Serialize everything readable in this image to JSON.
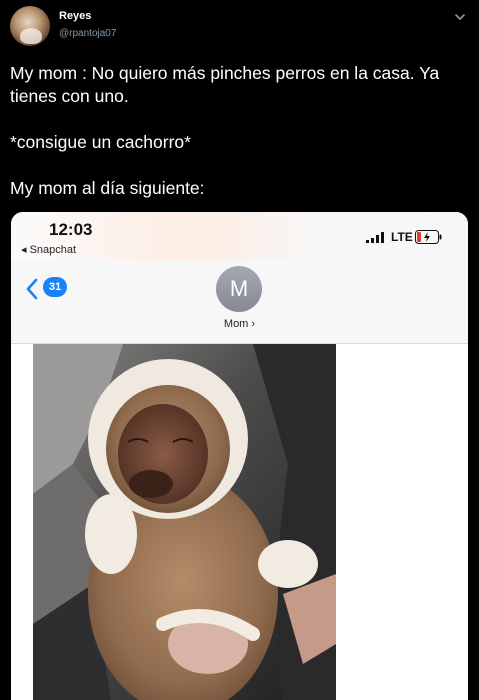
{
  "tweet": {
    "author": {
      "name": "Reyes",
      "handle": "@rpantoja07"
    },
    "lines": [
      "My mom : No quiero más pinches perros en la casa. Ya tienes con uno.",
      "*consigue un cachorro*",
      "My mom al día siguiente:"
    ]
  },
  "screenshot": {
    "status_bar": {
      "time": "12:03",
      "back_app": "◂ Snapchat",
      "network": "LTE"
    },
    "conversation": {
      "unread_count": "31",
      "contact_initial": "M",
      "contact_name": "Mom ›"
    },
    "photo_icon": "puppy-in-hooded-bear-suit-photo"
  },
  "colors": {
    "background": "#000000",
    "handle": "#8899a6",
    "imessage_blue": "#1a82f7",
    "battery_fill": "#e23b2e"
  }
}
